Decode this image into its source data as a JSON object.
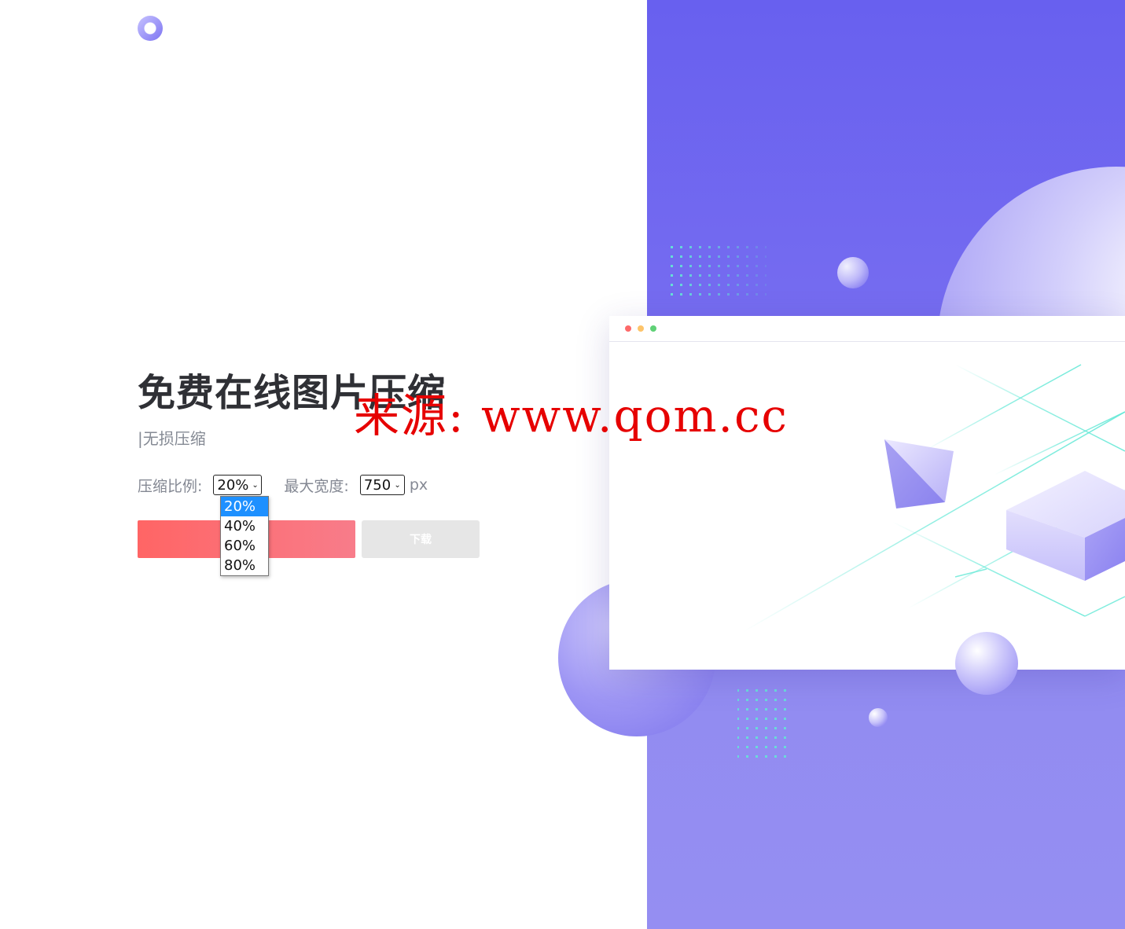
{
  "header": {
    "logo_icon": "ring-logo"
  },
  "hero": {
    "title": "免费在线图片压缩",
    "subtitle": "|无损压缩"
  },
  "form": {
    "ratio_label": "压缩比例:",
    "ratio_selected": "20%",
    "ratio_options": [
      "20%",
      "40%",
      "60%",
      "80%"
    ],
    "width_label": "最大宽度:",
    "width_selected": "750",
    "width_unit": "px"
  },
  "actions": {
    "upload_label": "",
    "download_label": "下载"
  },
  "watermark": {
    "text": "来源: www.qom.cc"
  },
  "colors": {
    "panel_top": "#6860ef",
    "panel_bottom": "#958ef2",
    "upload_gradient_start": "#ff6565",
    "upload_gradient_end": "#f87c8a",
    "download_bg": "#e6e6e6",
    "dropdown_highlight": "#1e90ff",
    "watermark": "#e60000",
    "title": "#2f3035"
  }
}
